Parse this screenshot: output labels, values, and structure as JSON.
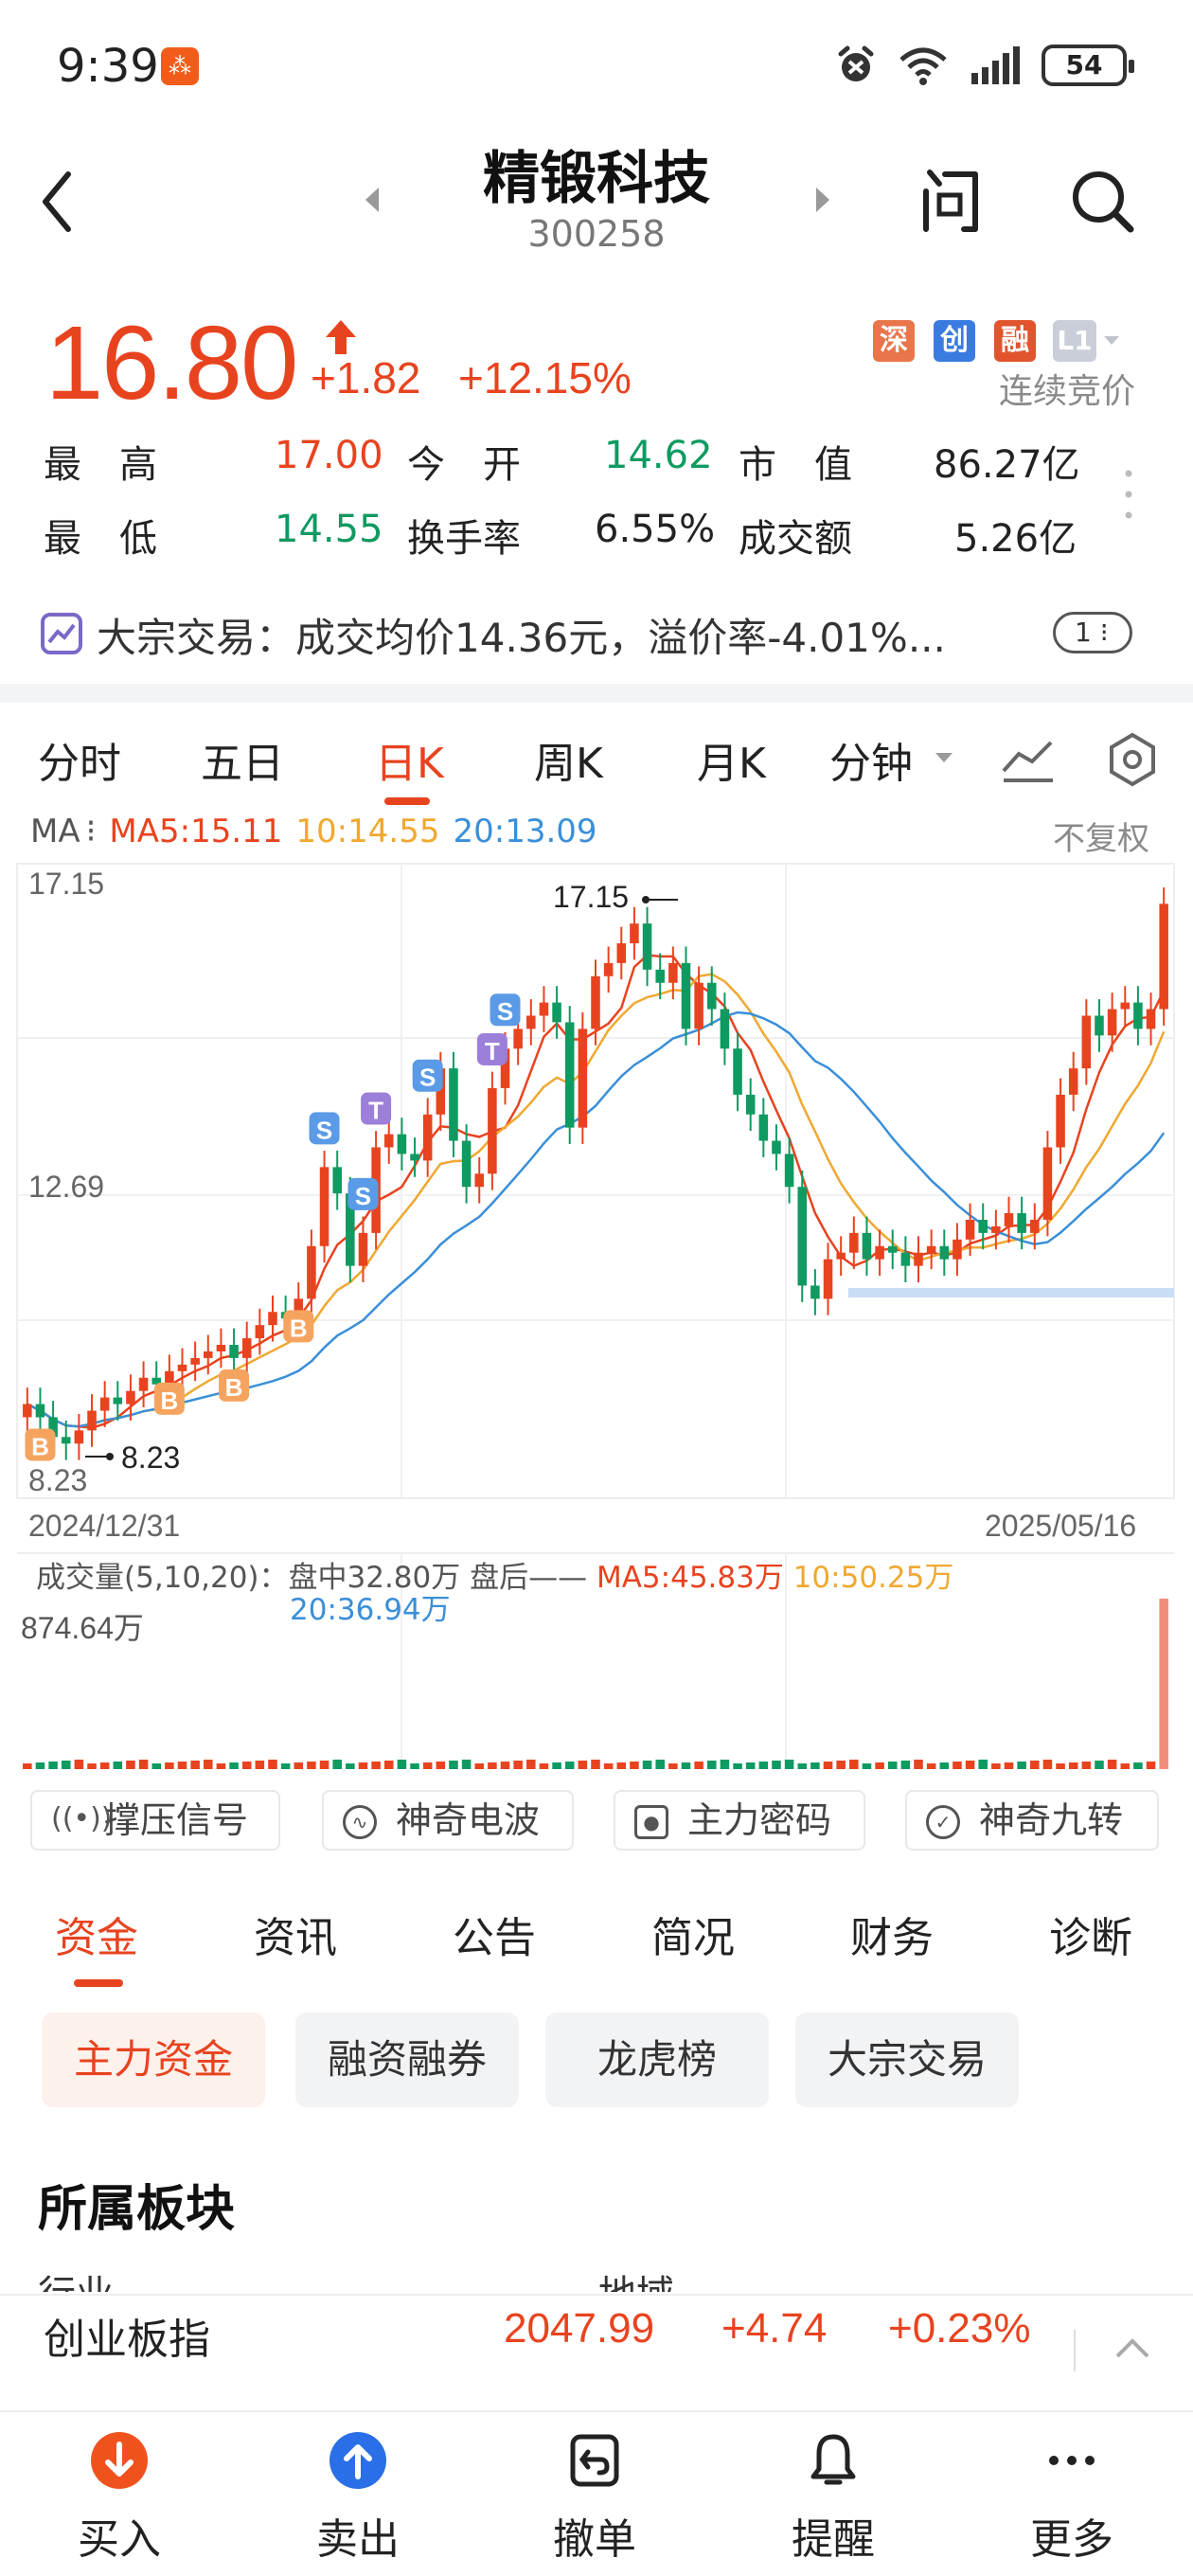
{
  "status_bar": {
    "time": "9:39",
    "battery": "54",
    "app_badge_icon": "app-notification-icon"
  },
  "header": {
    "name": "精锻科技",
    "code": "300258"
  },
  "quote": {
    "price": "16.80",
    "change": "+1.82",
    "change_pct": "+12.15%",
    "tags": [
      "深",
      "创",
      "融",
      "L1"
    ],
    "trade_status": "连续竞价"
  },
  "stats": {
    "high_label": "最　高",
    "high": "17.00",
    "open_label": "今　开",
    "open": "14.62",
    "mktcap_label": "市　值",
    "mktcap": "86.27亿",
    "low_label": "最　低",
    "low": "14.55",
    "turnover_label": "换手率",
    "turnover": "6.55%",
    "amount_label": "成交额",
    "amount": "5.26亿"
  },
  "notice": {
    "text": "大宗交易：成交均价14.36元，溢价率-4.01%...",
    "badge": "1"
  },
  "chart_tabs": [
    "分时",
    "五日",
    "日K",
    "周K",
    "月K",
    "分钟"
  ],
  "ma_legend": {
    "label": "MA",
    "ma5": "MA5:15.11",
    "ma10": "10:14.55",
    "ma20": "20:13.09",
    "adjust": "不复权"
  },
  "chart_data": {
    "type": "candlestick",
    "y_axis_labels": [
      "17.15",
      "12.69",
      "8.23"
    ],
    "x_axis_labels": [
      "2024/12/31",
      "2025/05/16"
    ],
    "high_annotation": "17.15",
    "low_annotation": "8.23",
    "ylim": [
      8.23,
      17.15
    ],
    "signals": [
      "B",
      "B",
      "B",
      "B",
      "S",
      "S",
      "S",
      "S",
      "T",
      "T"
    ],
    "closes": [
      9.2,
      9.0,
      8.7,
      8.6,
      8.8,
      9.1,
      9.3,
      9.2,
      9.4,
      9.6,
      9.5,
      9.7,
      9.8,
      9.9,
      10.0,
      10.1,
      9.9,
      10.2,
      10.4,
      10.6,
      10.5,
      10.8,
      11.6,
      12.8,
      12.4,
      11.3,
      11.8,
      13.1,
      13.3,
      13.0,
      12.9,
      13.6,
      14.3,
      13.2,
      12.5,
      12.7,
      14.0,
      14.6,
      14.9,
      15.1,
      15.3,
      15.0,
      13.4,
      14.9,
      15.7,
      15.9,
      16.2,
      16.5,
      15.8,
      15.6,
      15.9,
      14.9,
      15.6,
      15.2,
      14.6,
      13.9,
      13.6,
      13.2,
      13.0,
      12.5,
      11.0,
      10.8,
      11.4,
      11.5,
      11.8,
      11.4,
      11.6,
      11.5,
      11.3,
      11.5,
      11.6,
      11.4,
      11.7,
      12.0,
      11.8,
      11.9,
      12.1,
      11.8,
      12.0,
      13.1,
      13.9,
      14.3,
      15.1,
      14.8,
      15.2,
      15.3,
      14.9,
      15.2,
      16.8
    ],
    "volume": {
      "legend": "成交量(5,10,20)：盘中32.80万 盘后—— ",
      "ma5": "MA5:45.83万",
      "ma10": "10:50.25万",
      "ma20": "20:36.94万",
      "max_label": "874.64万"
    }
  },
  "indicators": [
    "撑压信号",
    "神奇电波",
    "主力密码",
    "神奇九转"
  ],
  "info_tabs": [
    "资金",
    "资讯",
    "公告",
    "简况",
    "财务",
    "诊断"
  ],
  "sub_tabs": [
    "主力资金",
    "融资融券",
    "龙虎榜",
    "大宗交易"
  ],
  "section": {
    "title": "所属板块",
    "col1": "行业",
    "col2": "地域"
  },
  "index_bar": {
    "name": "创业板指",
    "value": "2047.99",
    "change": "+4.74",
    "pct": "+0.23%"
  },
  "bottom_nav": [
    "买入",
    "卖出",
    "撤单",
    "提醒",
    "更多"
  ],
  "colors": {
    "up": "#e8431f",
    "down": "#0f9a61",
    "ma5": "#e8431f",
    "ma10": "#f0a830",
    "ma20": "#3a8fd9"
  }
}
